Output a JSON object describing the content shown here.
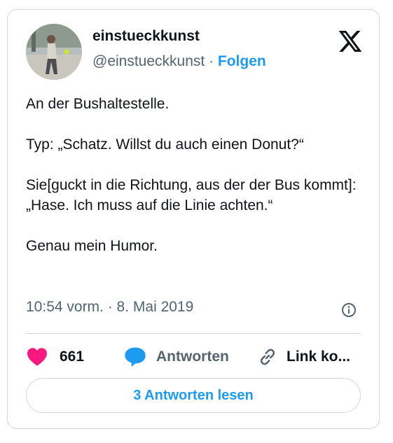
{
  "author": {
    "display_name": "einstueckkunst",
    "handle": "@einstueckkunst",
    "separator": " · ",
    "follow_label": "Folgen"
  },
  "tweet": {
    "paragraphs": [
      "An der Bushaltestelle.",
      "Typ: „Schatz. Willst  du auch einen Donut?“",
      "Sie[guckt in die Richtung, aus der der Bus kommt]: „Hase. Ich muss auf die Linie achten.“",
      "Genau mein Humor."
    ],
    "timestamp": "10:54 vorm. · 8. Mai 2019"
  },
  "actions": {
    "likes_count": "661",
    "reply_label": "Antworten",
    "link_label": "Link ko..."
  },
  "read_replies_label": "3 Antworten lesen",
  "colors": {
    "accent": "#1d9bf0",
    "like": "#f91880",
    "text": "#0f1419",
    "muted": "#536471",
    "border": "#cfd9de"
  },
  "icons": [
    "x-logo-icon",
    "info-icon",
    "heart-icon",
    "speech-bubble-icon",
    "link-icon"
  ]
}
